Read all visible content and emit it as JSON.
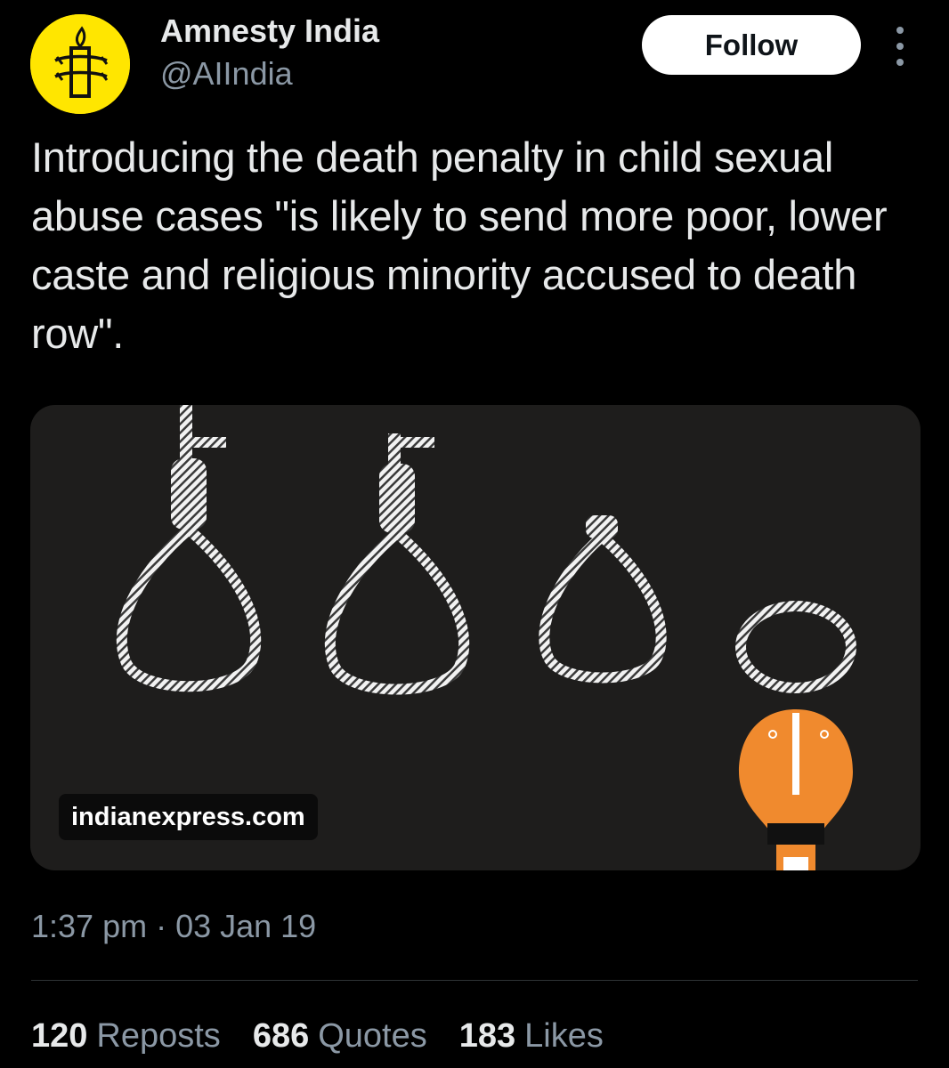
{
  "author": {
    "display_name": "Amnesty India",
    "handle": "@AIIndia",
    "avatar_icon": "amnesty-candle-icon",
    "avatar_color": "#ffe600"
  },
  "actions": {
    "follow_label": "Follow",
    "more_icon": "more-vertical-icon"
  },
  "tweet": {
    "text": "Introducing the death penalty in child sexual abuse cases \"is likely to send more poor, lower caste and religious minority accused to death row\".",
    "timestamp": "1:37 pm · 03 Jan 19"
  },
  "media": {
    "source": "indianexpress.com",
    "background": "#1e1d1c"
  },
  "stats": [
    {
      "count": "120",
      "label": "Reposts"
    },
    {
      "count": "686",
      "label": "Quotes"
    },
    {
      "count": "183",
      "label": "Likes"
    }
  ],
  "colors": {
    "background": "#000000",
    "text_primary": "#e7e9ea",
    "text_secondary": "#8b98a5",
    "divider": "#2f3336",
    "accent_orange": "#f08a2e"
  }
}
